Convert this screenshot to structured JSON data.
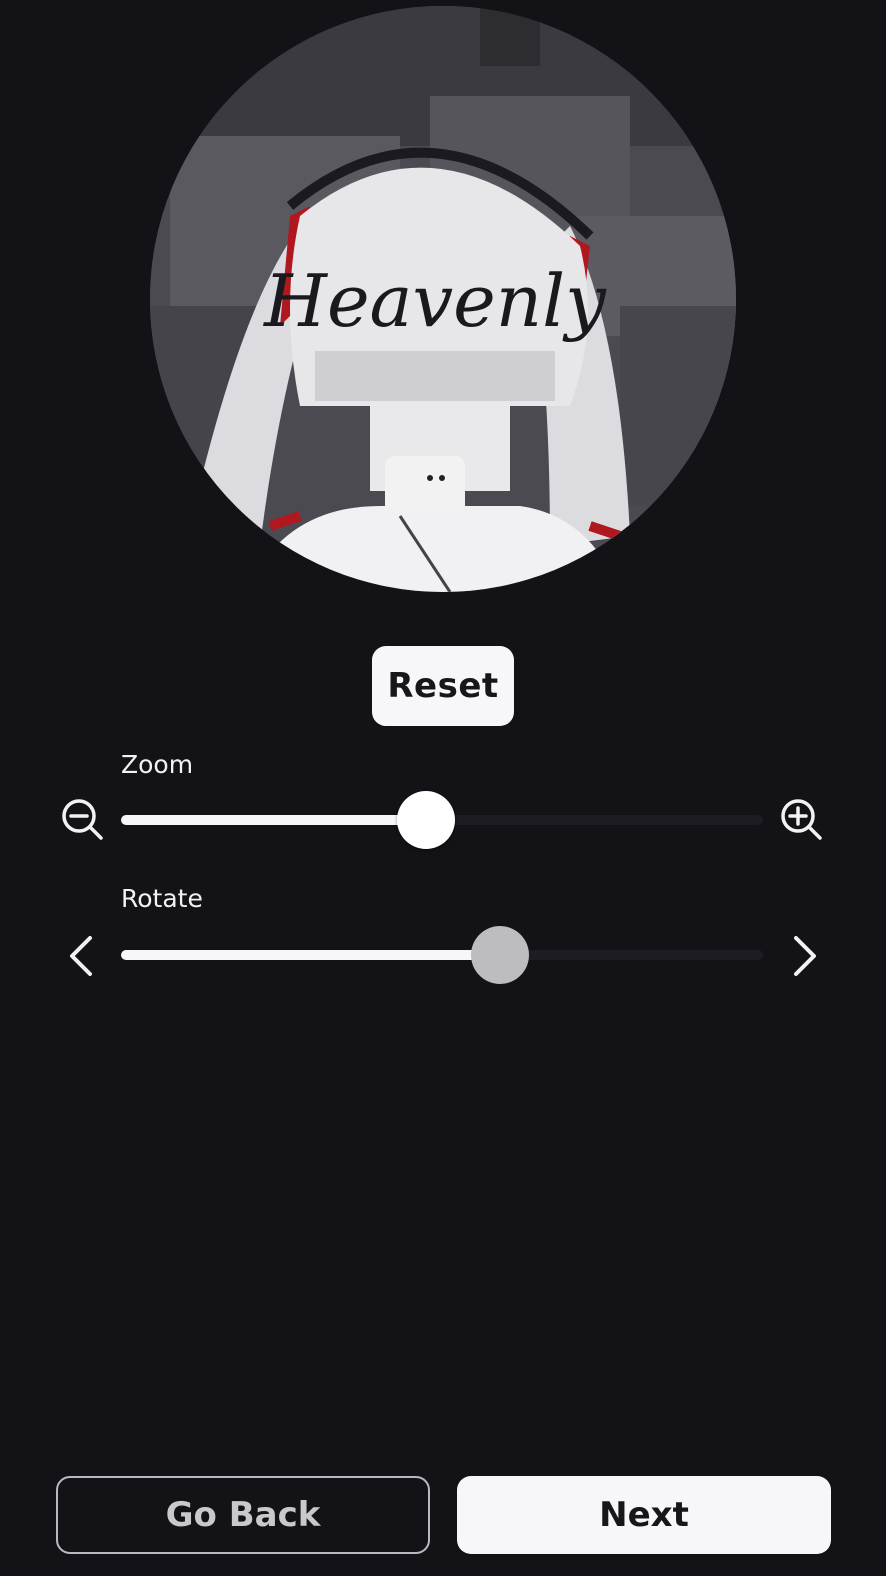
{
  "avatar": {
    "hair_text": "Heavenly",
    "icon": "avatar-headshot-preview"
  },
  "reset": {
    "label": "Reset"
  },
  "zoom": {
    "label": "Zoom",
    "value_fraction": 0.475,
    "decrease_icon": "zoom-out-icon",
    "increase_icon": "zoom-in-icon"
  },
  "rotate": {
    "label": "Rotate",
    "value_fraction": 0.59,
    "decrease_icon": "chevron-left-icon",
    "increase_icon": "chevron-right-icon"
  },
  "footer": {
    "back_label": "Go Back",
    "next_label": "Next"
  },
  "colors": {
    "background": "#131217",
    "button_light": "#f7f7f9",
    "track_inactive": "#1d1c22",
    "rotate_thumb": "#bdbdc0"
  }
}
